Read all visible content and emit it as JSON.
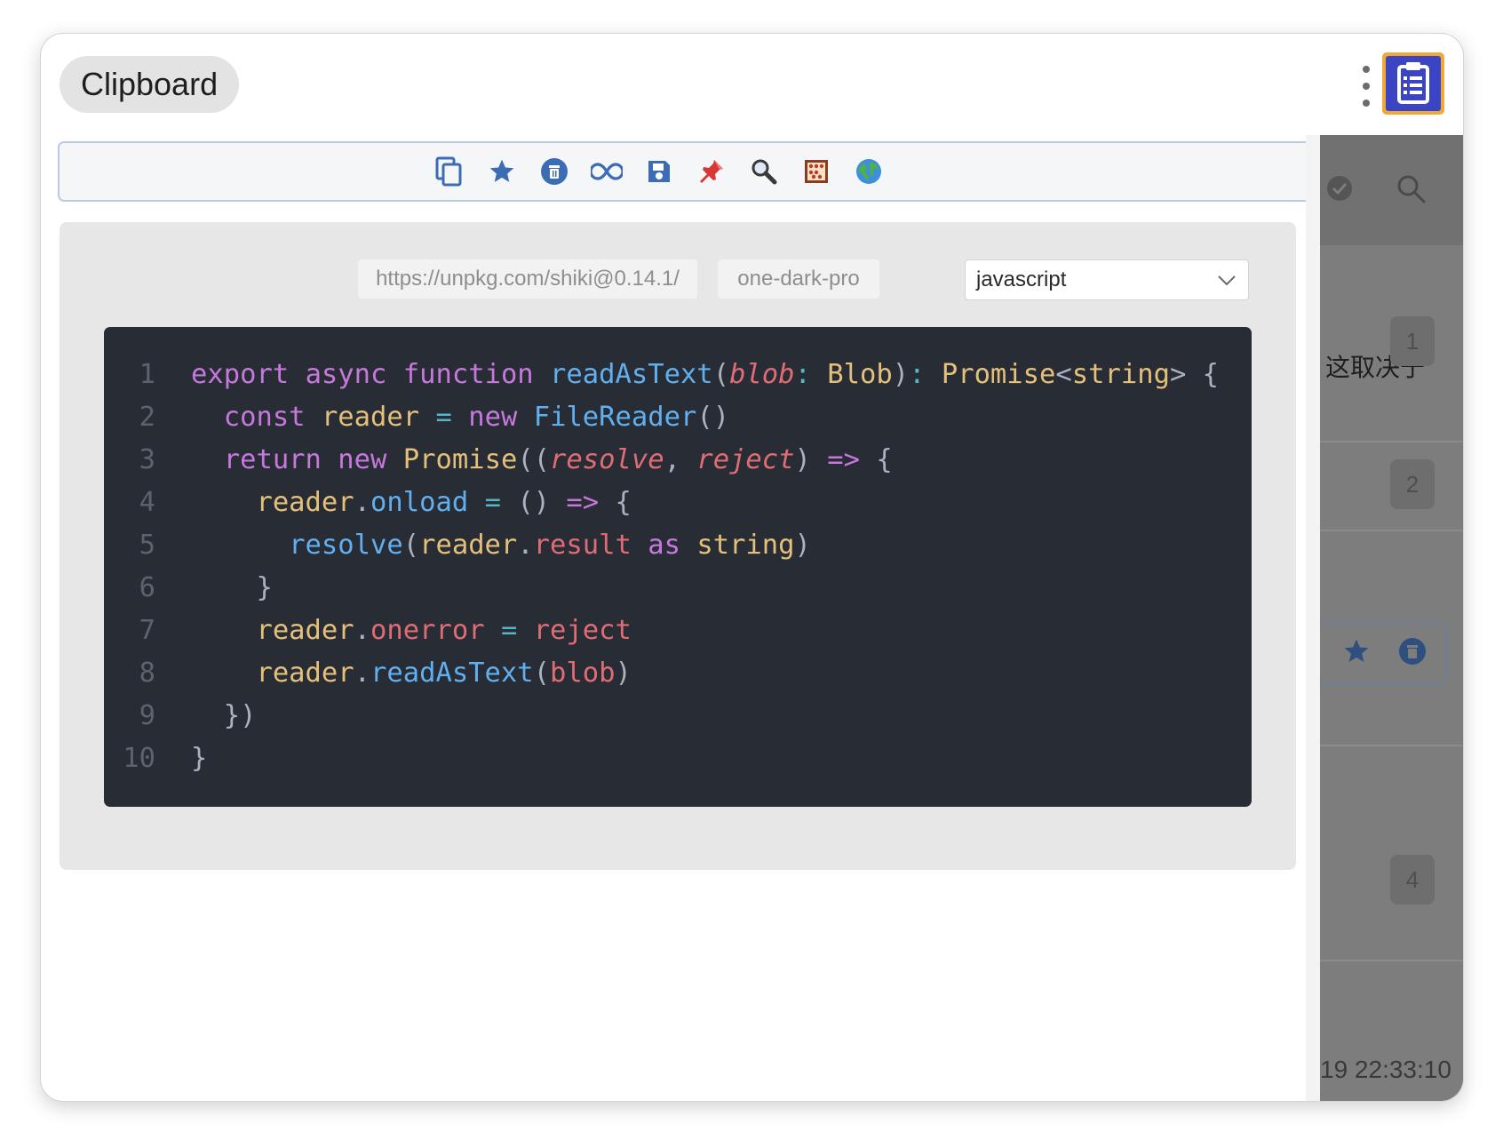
{
  "app": {
    "title": "Clipboard"
  },
  "toolbar": {
    "items": [
      "copy-icon",
      "star-icon",
      "delete-icon",
      "infinity-icon",
      "save-icon",
      "pin-icon",
      "magnifier-icon",
      "abacus-icon",
      "globe-icon"
    ],
    "accent": "#3b6cb4"
  },
  "settings": {
    "cdn_url": "https://unpkg.com/shiki@0.14.1/",
    "theme": "one-dark-pro",
    "language": "javascript"
  },
  "code": {
    "language": "javascript",
    "lines": [
      "export async function readAsText(blob: Blob): Promise<string> {",
      "  const reader = new FileReader()",
      "  return new Promise((resolve, reject) => {",
      "    reader.onload = () => {",
      "      resolve(reader.result as string)",
      "    }",
      "    reader.onerror = reject",
      "    reader.readAsText(blob)",
      "  })",
      "}"
    ],
    "line_numbers": [
      "1",
      "2",
      "3",
      "4",
      "5",
      "6",
      "7",
      "8",
      "9",
      "10"
    ]
  },
  "sidebar": {
    "badges": [
      "1",
      "2",
      "4"
    ],
    "snippet_text": "这取决于",
    "timestamp": "19 22:33:10"
  },
  "colors": {
    "code_bg": "#282c34",
    "panel_bg": "#e7e7e7",
    "sidebar_overlay": "#7d7d7d",
    "app_icon": "#3b45c4"
  }
}
